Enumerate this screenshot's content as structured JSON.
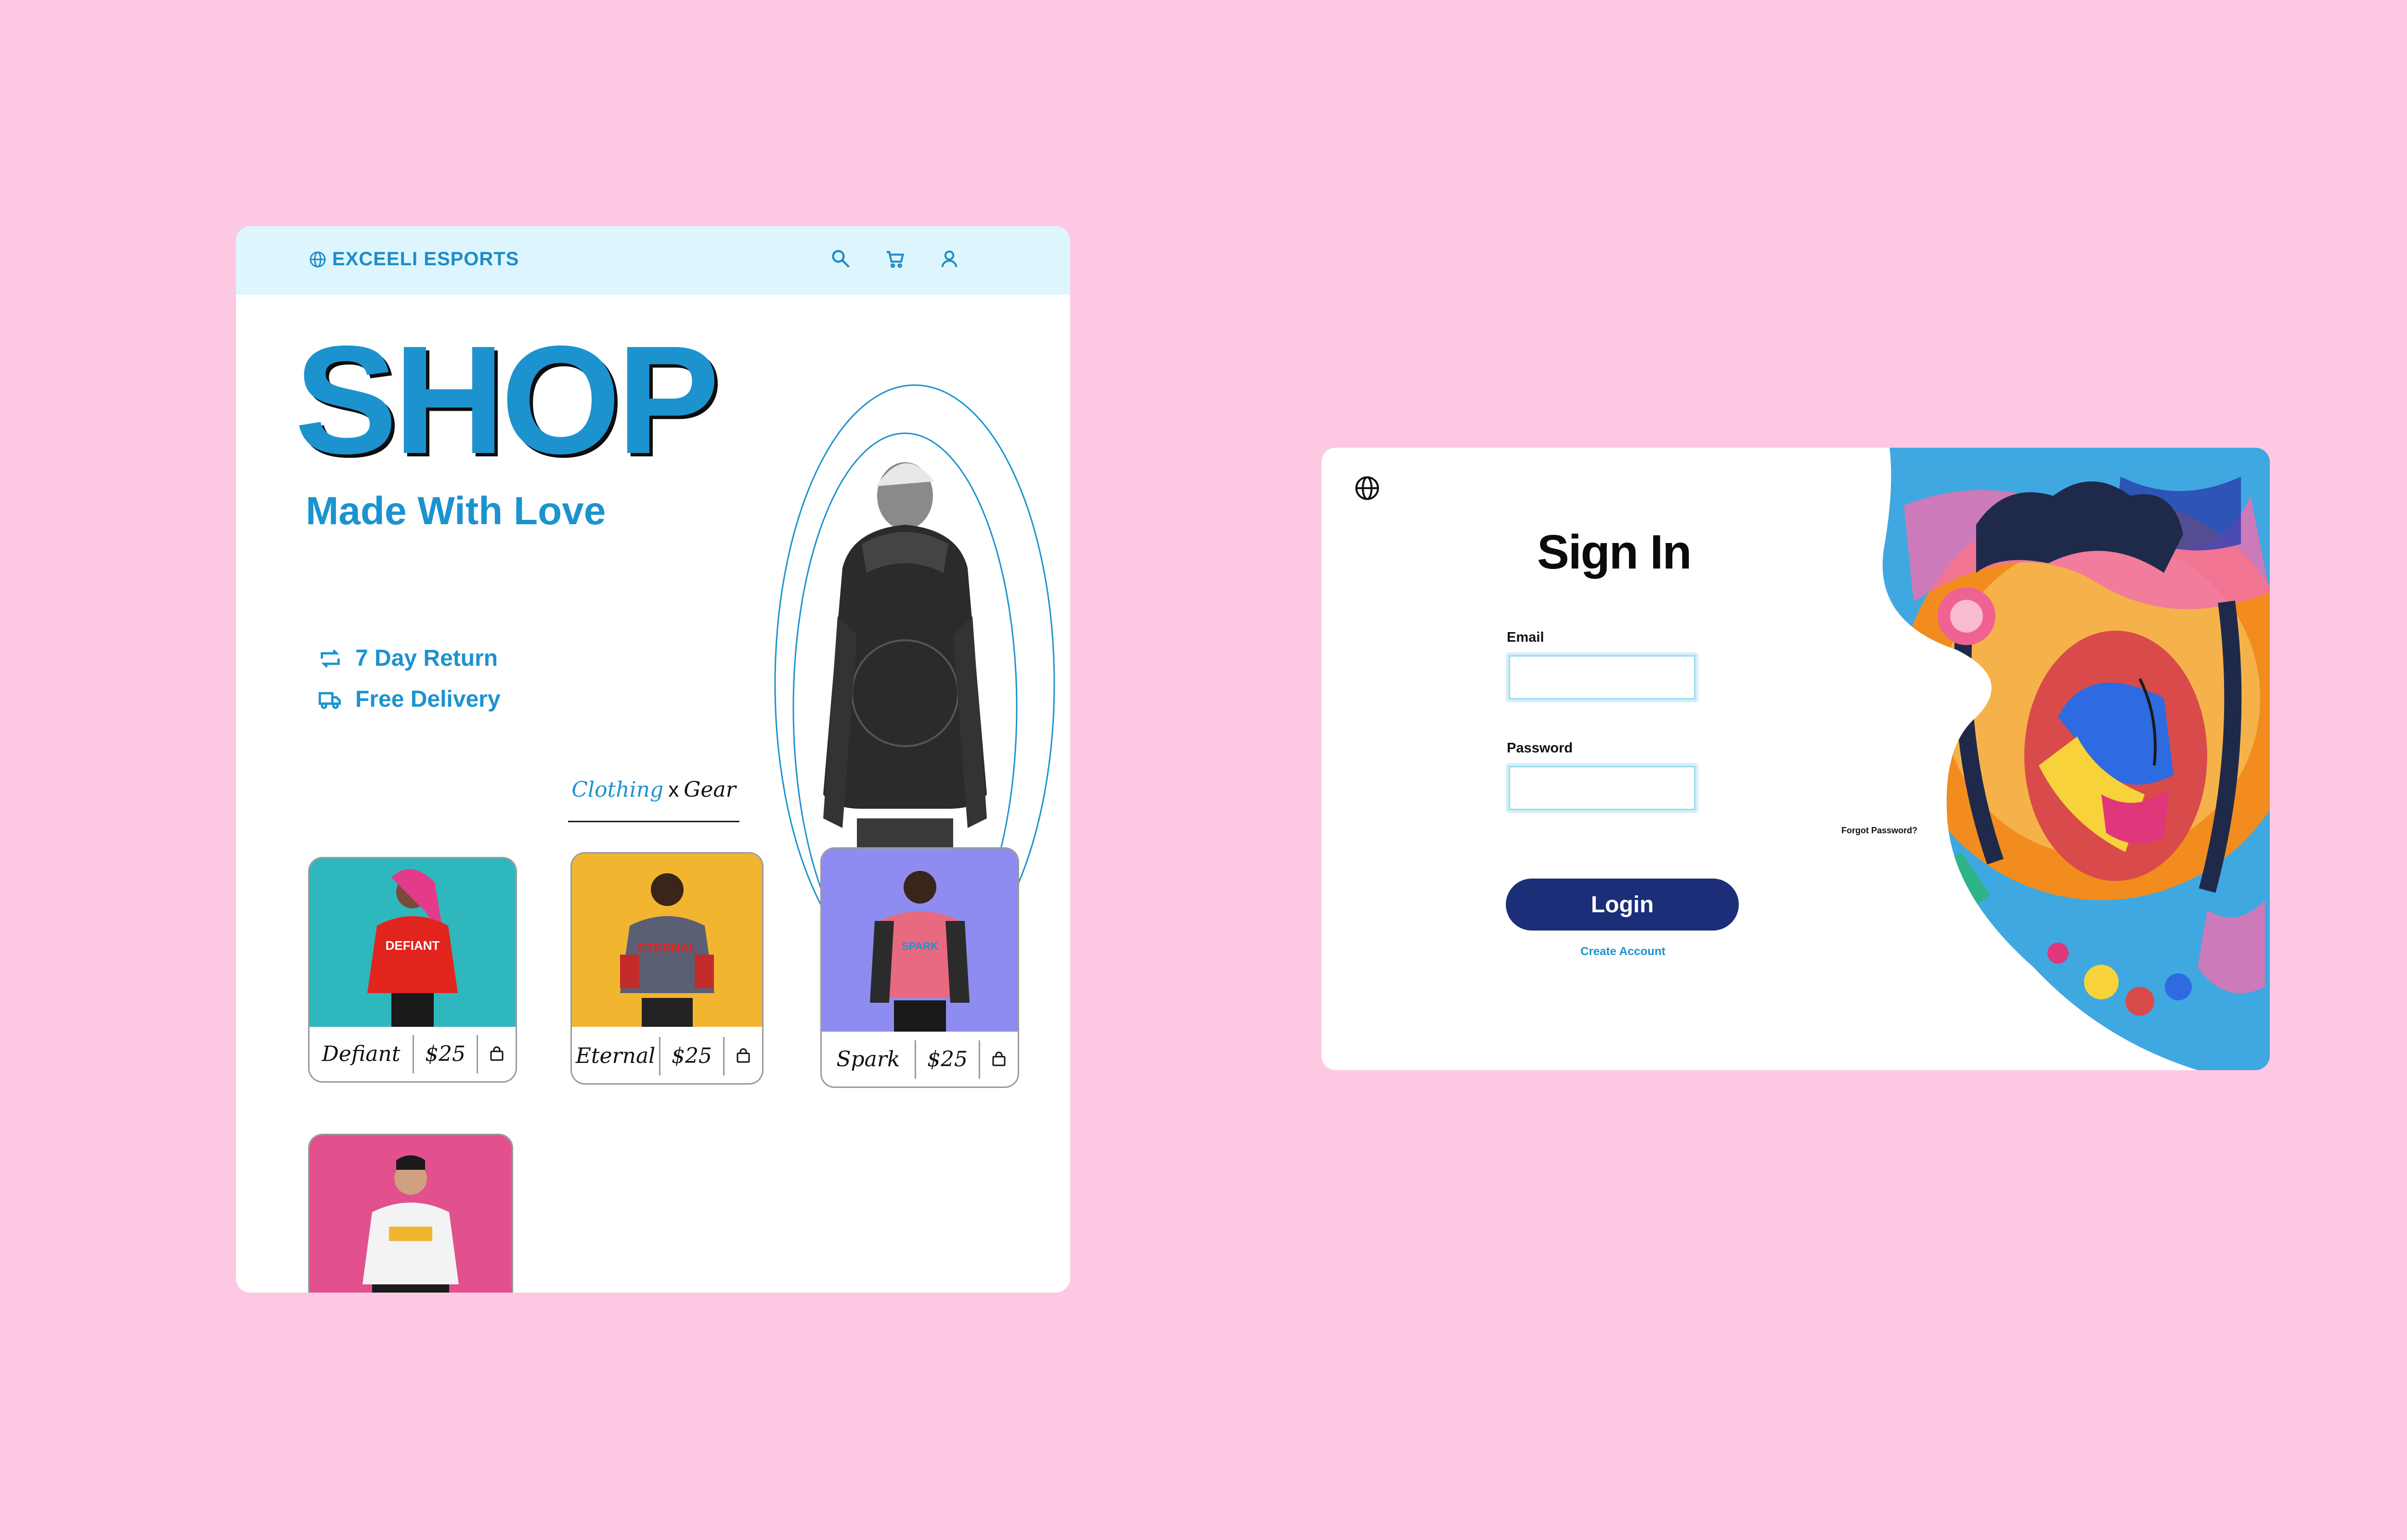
{
  "shop": {
    "brand": "EXCEELI ESPORTS",
    "header_icons": [
      "search-icon",
      "cart-icon",
      "user-icon"
    ],
    "hero_title": "SHOP",
    "hero_subtitle": "Made With Love",
    "perks": [
      {
        "icon": "return-icon",
        "label": "7 Day Return"
      },
      {
        "icon": "truck-icon",
        "label": "Free Delivery"
      }
    ],
    "tabs": {
      "clothing": "Clothing",
      "separator": "x",
      "gear": "Gear"
    },
    "products": [
      {
        "name": "Defiant",
        "price": "$25",
        "bg": "#2FB7BE",
        "shirt": "#E2241E"
      },
      {
        "name": "Eternal",
        "price": "$25",
        "bg": "#F2B530",
        "shirt": "#5A5F74"
      },
      {
        "name": "Spark",
        "price": "$25",
        "bg": "#8E8CF0",
        "shirt": "#E86A80"
      },
      {
        "name": "",
        "price": "",
        "bg": "#E2508E",
        "shirt": "#F3F3F3"
      }
    ]
  },
  "signin": {
    "title": "Sign In",
    "email_label": "Email",
    "email_value": "",
    "password_label": "Password",
    "password_value": "",
    "forgot": "Forgot Password?",
    "login": "Login",
    "create": "Create Account"
  },
  "colors": {
    "background": "#FDC8E2",
    "accent_blue": "#1C93CF",
    "header_bg": "#DDF6FD",
    "login_button": "#1C2E78"
  }
}
